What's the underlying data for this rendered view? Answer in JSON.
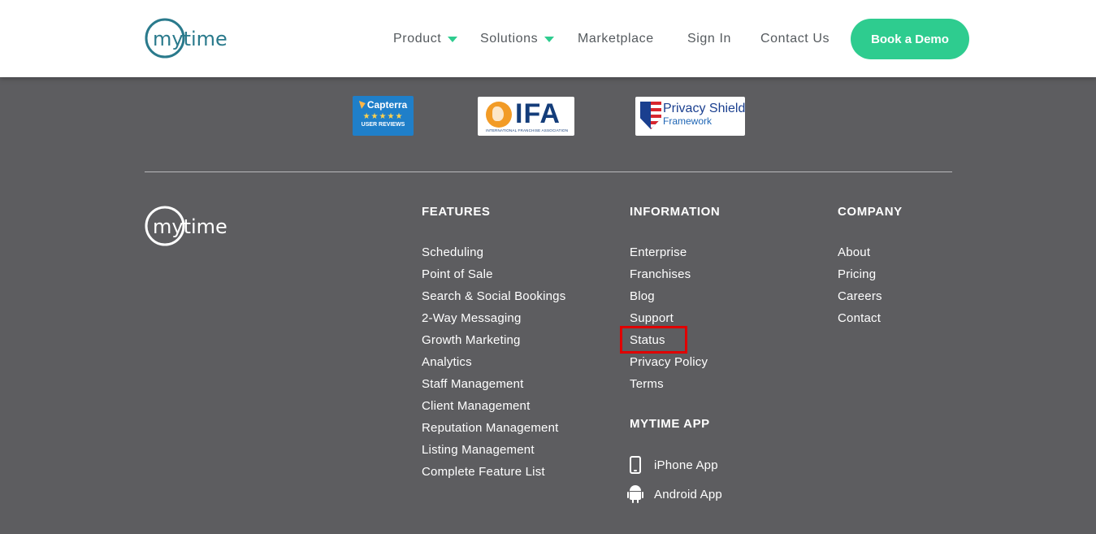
{
  "header": {
    "logo_text": "mytime",
    "nav": [
      {
        "label": "Product"
      },
      {
        "label": "Solutions"
      },
      {
        "label": "Marketplace"
      },
      {
        "label": "Sign In"
      },
      {
        "label": "Contact Us"
      }
    ],
    "cta_label": "Book a Demo"
  },
  "badges": {
    "capterra": {
      "title": "Capterra",
      "stars": "★★★★★",
      "sub": "USER REVIEWS"
    },
    "ifa": {
      "title": "IFA",
      "sub": "INTERNATIONAL FRANCHISE ASSOCIATION"
    },
    "privacy_shield": {
      "title": "Privacy Shield",
      "sub": "Framework"
    }
  },
  "footer": {
    "logo_text": "mytime",
    "features": {
      "title": "FEATURES",
      "links": [
        "Scheduling",
        "Point of Sale",
        "Search & Social Bookings",
        "2-Way Messaging",
        "Growth Marketing",
        "Analytics",
        "Staff Management",
        "Client Management",
        "Reputation Management",
        "Listing Management",
        "Complete Feature List"
      ]
    },
    "information": {
      "title": "INFORMATION",
      "links": [
        "Enterprise",
        "Franchises",
        "Blog",
        "Support",
        "Status",
        "Privacy Policy",
        "Terms"
      ]
    },
    "app": {
      "title": "MYTIME APP",
      "iphone": "iPhone App",
      "android": "Android App"
    },
    "company": {
      "title": "COMPANY",
      "links": [
        "About",
        "Pricing",
        "Careers",
        "Contact"
      ]
    }
  },
  "colors": {
    "accent": "#2ecc8f",
    "logo_teal": "#2a7a8c",
    "footer_bg": "#5d5d60",
    "highlight": "#e00000"
  }
}
